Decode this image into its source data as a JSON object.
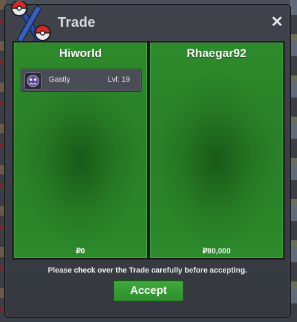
{
  "window": {
    "title": "Trade",
    "close_glyph": "✕"
  },
  "players": [
    {
      "name": "Hiworld",
      "money": "₽0",
      "items": [
        {
          "name": "Gastly",
          "level": "Lvl: 19",
          "icon": "pokemon-gastly-icon"
        }
      ]
    },
    {
      "name": "Rhaegar92",
      "money": "₽80,000",
      "items": []
    }
  ],
  "notice": "Please check over the Trade carefully before accepting.",
  "accept_label": "Accept",
  "colors": {
    "panel_green": "#2a7f28",
    "accept_green": "#3fa83c",
    "window_bg": "#3b3e45"
  }
}
